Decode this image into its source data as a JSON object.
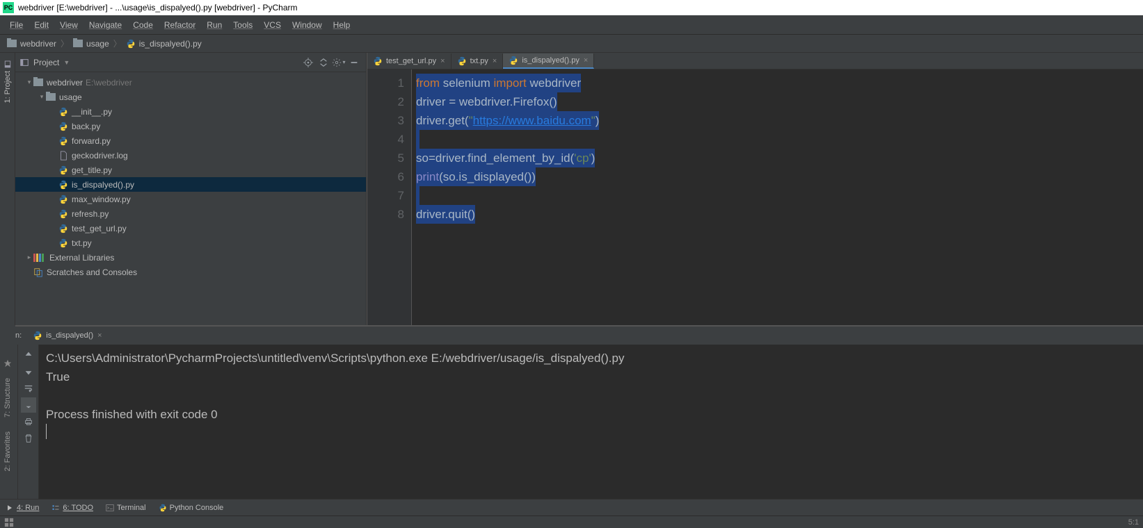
{
  "title_bar": {
    "app_badge": "PC",
    "text": "webdriver [E:\\webdriver] - ...\\usage\\is_dispalyed().py [webdriver] - PyCharm"
  },
  "menu": [
    "File",
    "Edit",
    "View",
    "Navigate",
    "Code",
    "Refactor",
    "Run",
    "Tools",
    "VCS",
    "Window",
    "Help"
  ],
  "breadcrumbs": [
    {
      "icon": "folder",
      "text": "webdriver"
    },
    {
      "icon": "folder",
      "text": "usage"
    },
    {
      "icon": "python",
      "text": "is_dispalyed().py"
    }
  ],
  "left_tool_tab": "1: Project",
  "project_panel": {
    "title": "Project",
    "toolbar_icons": [
      "target-icon",
      "collapse-icon",
      "gear-icon",
      "hide-icon"
    ]
  },
  "tree": [
    {
      "depth": 0,
      "arrow": "▾",
      "icon": "folder",
      "label": "webdriver",
      "suffix": "E:\\webdriver"
    },
    {
      "depth": 1,
      "arrow": "▾",
      "icon": "folder",
      "label": "usage"
    },
    {
      "depth": 2,
      "icon": "python",
      "label": "__init__.py"
    },
    {
      "depth": 2,
      "icon": "python",
      "label": "back.py"
    },
    {
      "depth": 2,
      "icon": "python",
      "label": "forward.py"
    },
    {
      "depth": 2,
      "icon": "file",
      "label": "geckodriver.log"
    },
    {
      "depth": 2,
      "icon": "python",
      "label": "get_title.py"
    },
    {
      "depth": 2,
      "icon": "python",
      "label": "is_dispalyed().py",
      "selected": true
    },
    {
      "depth": 2,
      "icon": "python",
      "label": "max_window.py"
    },
    {
      "depth": 2,
      "icon": "python",
      "label": "refresh.py"
    },
    {
      "depth": 2,
      "icon": "python",
      "label": "test_get_url.py"
    },
    {
      "depth": 2,
      "icon": "python",
      "label": "txt.py"
    },
    {
      "depth": 0,
      "arrow": "▸",
      "icon": "lib",
      "label": "External Libraries"
    },
    {
      "depth": 0,
      "icon": "scratch",
      "label": "Scratches and Consoles"
    }
  ],
  "editor_tabs": [
    {
      "label": "test_get_url.py",
      "active": false
    },
    {
      "label": "txt.py",
      "active": false
    },
    {
      "label": "is_dispalyed().py",
      "active": true
    }
  ],
  "editor": {
    "line_numbers": [
      "1",
      "2",
      "3",
      "4",
      "5",
      "6",
      "7",
      "8"
    ],
    "code_tokens": [
      [
        {
          "c": "kw",
          "t": "from "
        },
        {
          "c": "txt",
          "t": "selenium "
        },
        {
          "c": "imp",
          "t": "import "
        },
        {
          "c": "txt",
          "t": "webdriver"
        }
      ],
      [
        {
          "c": "txt",
          "t": "driver = webdriver.Firefox()"
        }
      ],
      [
        {
          "c": "txt",
          "t": "driver.get("
        },
        {
          "c": "str",
          "t": "\""
        },
        {
          "c": "url",
          "t": "https://www.baidu.com"
        },
        {
          "c": "str",
          "t": "\""
        },
        {
          "c": "txt",
          "t": ")"
        }
      ],
      [
        {
          "c": "txt",
          "t": ""
        }
      ],
      [
        {
          "c": "txt",
          "t": "so=driver.find_element_by_id("
        },
        {
          "c": "str",
          "t": "'cp'"
        },
        {
          "c": "txt",
          "t": ")"
        }
      ],
      [
        {
          "c": "builtin",
          "t": "print"
        },
        {
          "c": "txt",
          "t": "(so.is_displayed())"
        }
      ],
      [
        {
          "c": "txt",
          "t": ""
        }
      ],
      [
        {
          "c": "txt",
          "t": "driver.quit()"
        }
      ]
    ]
  },
  "run_panel": {
    "title": "Run:",
    "tab": "is_dispalyed()",
    "console_lines": [
      "C:\\Users\\Administrator\\PycharmProjects\\untitled\\venv\\Scripts\\python.exe E:/webdriver/usage/is_dispalyed().py",
      "True",
      "",
      "Process finished with exit code 0"
    ]
  },
  "left_lower_tabs": [
    "7: Structure",
    "2: Favorites"
  ],
  "status_bar_tools": [
    {
      "icon": "play",
      "label": "4: Run",
      "underline": true
    },
    {
      "icon": "todo",
      "label": "6: TODO",
      "underline": true
    },
    {
      "icon": "terminal",
      "label": "Terminal"
    },
    {
      "icon": "python",
      "label": "Python Console"
    }
  ],
  "caret_pos": "5:1"
}
